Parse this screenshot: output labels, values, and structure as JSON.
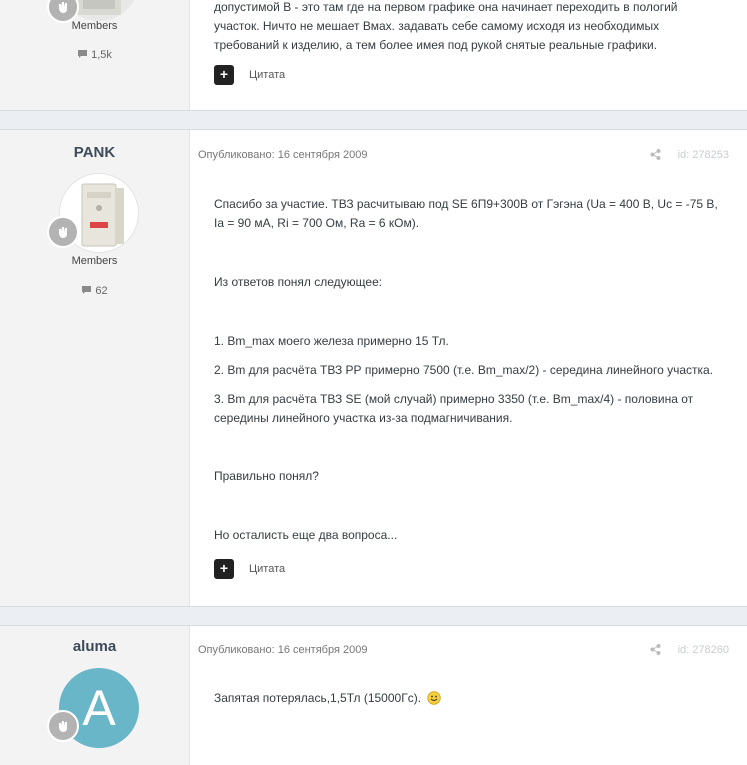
{
  "post1": {
    "group": "Members",
    "count": "1,5k",
    "body_lines": [
      "допустимой В - это там где на первом графике она начинает переходить в пологий",
      "участок. Ничто не мешает Вмах. задавать себе самому исходя из необходимых",
      "требований к изделию, а тем более имея под рукой снятые реальные графики."
    ],
    "quote_label": "Цитата"
  },
  "post2": {
    "username": "PANK",
    "group": "Members",
    "count": "62",
    "published": "Опубликовано: 16 сентября 2009",
    "id": "id: 278253",
    "paragraphs": [
      "Спасибо за участие. ТВЗ расчитываю под SE 6П9+300В от Гэгэна (Ua = 400 В, Uc = -75 В,",
      "Ia = 90 мА, Ri = 700 Ом, Ra = 6 кОм).",
      "Из ответов понял следующее:",
      "1. Bm_max моего железа примерно 15 Тл.",
      "2. Bm для расчёта ТВЗ РР примерно 7500 (т.е. Bm_max/2) - середина линейного участка.",
      "3. Bm для расчёта ТВЗ SE (мой случай) примерно 3350 (т.е. Bm_max/4) - половина от",
      "середины линейного участка из-за подмагничивания.",
      "Правильно понял?",
      "Но осталисть еще два вопроса..."
    ],
    "quote_label": "Цитата"
  },
  "post3": {
    "username": "aluma",
    "avatar_letter": "A",
    "published": "Опубликовано: 16 сентября 2009",
    "id": "id: 278260",
    "body": "Запятая потерялась,1,5Тл (15000Гс).",
    "emoji": "smile-icon"
  },
  "colors": {
    "avatar_bg": "#6ab6c9",
    "quote_bg": "#222222",
    "author_bg": "#f3f3f3"
  }
}
